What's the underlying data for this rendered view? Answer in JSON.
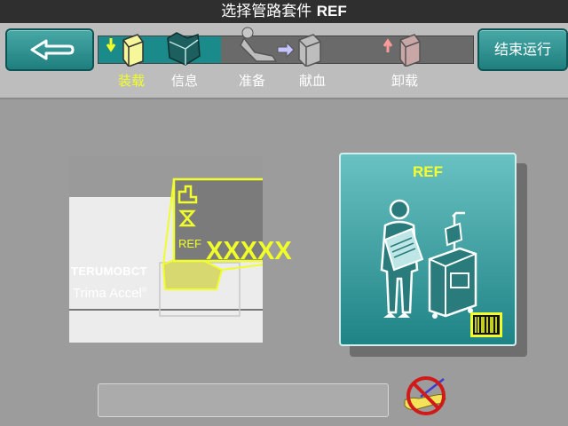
{
  "header": {
    "title": "选择管路套件",
    "title_code": "REF"
  },
  "nav": {
    "end_run_label": "结束运行"
  },
  "steps": [
    {
      "label": "装载",
      "active": true
    },
    {
      "label": "信息",
      "active": false
    },
    {
      "label": "准备",
      "active": false
    },
    {
      "label": "献血",
      "active": false
    },
    {
      "label": "卸载",
      "active": false
    }
  ],
  "kit": {
    "brand": "TERUMOBCT",
    "product": "Trima Accel",
    "reg": "®",
    "ref_prefix": "REF",
    "ref_value": "XXXXX"
  },
  "ref_card": {
    "title": "REF"
  },
  "status": {
    "message": ""
  },
  "colors": {
    "accent_yellow": "#f0ff28",
    "teal": "#1f8385",
    "active_track": "#1a8a8a"
  }
}
